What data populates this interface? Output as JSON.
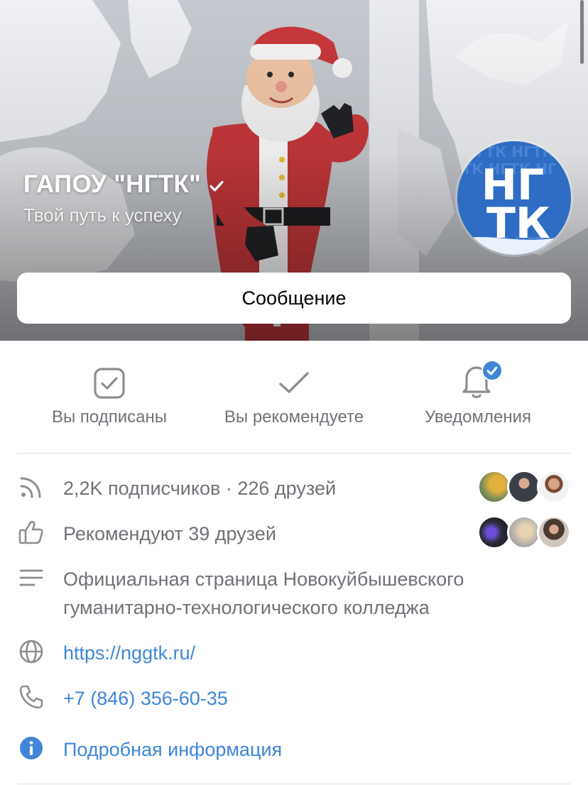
{
  "group": {
    "title": "ГАПОУ \"НГТК\"",
    "status": "Твой путь к успеху",
    "verified": true,
    "avatar_text_top": "НГ",
    "avatar_text_bottom": "ТК"
  },
  "buttons": {
    "message_label": "Сообщение"
  },
  "actions": {
    "subscribed_label": "Вы подписаны",
    "recommend_label": "Вы рекомендуете",
    "notifications_label": "Уведомления"
  },
  "info": {
    "subscribers_text": "2,2K подписчиков · 226 друзей",
    "recommend_text": "Рекомендуют 39 друзей",
    "description_line1": "Официальная страница Новокуйбышевского",
    "description_line2": "гуманитарно-технологического колледжа",
    "website": "https://nggtk.ru/",
    "phone": "+7 (846) 356-60-35",
    "details_label": "Подробная информация"
  },
  "colors": {
    "accent": "#3f86d6",
    "secondary_text": "#6e7277",
    "icon_gray": "#8b8f94",
    "divider": "#dcdee2",
    "santa_red": "#c8383b"
  },
  "icons": {
    "verified": "checkmark-icon",
    "subscribed": "checked-square-icon",
    "recommend": "checkmark-icon",
    "notifications": "bell-check-icon",
    "subscribers": "rss-icon",
    "recommends": "thumbs-up-icon",
    "description": "text-lines-icon",
    "website": "globe-icon",
    "phone": "phone-icon",
    "details": "info-icon"
  }
}
